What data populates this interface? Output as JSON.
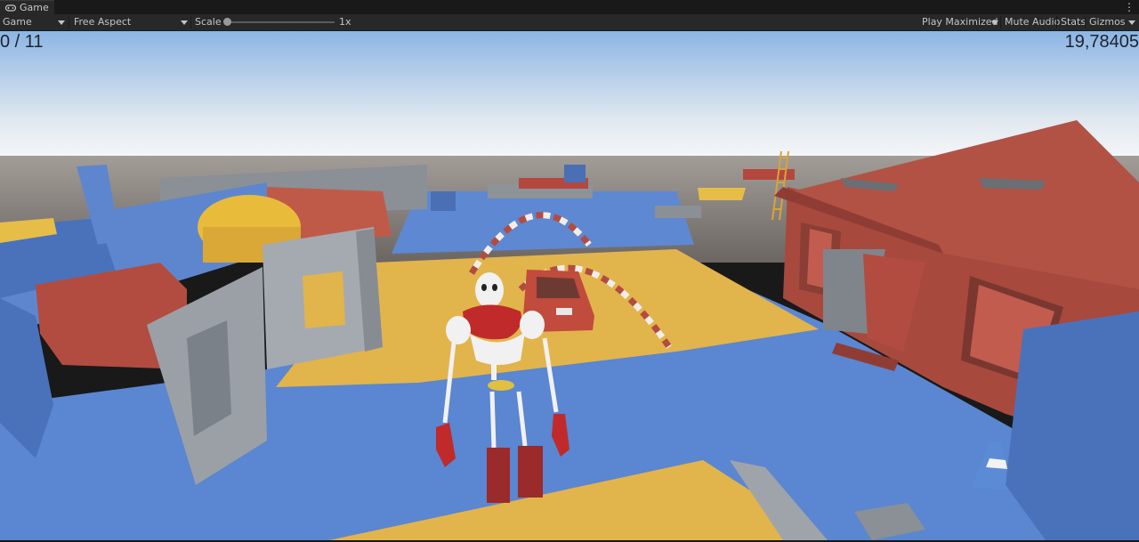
{
  "tab": {
    "title": "Game",
    "icon": "gamepad-icon",
    "menu": "⋮"
  },
  "toolbar": {
    "display": "Game",
    "aspect": "Free Aspect",
    "scale_label": "Scale",
    "scale_value": "1x",
    "scale_fraction": 0.0,
    "play_mode": "Play Maximized",
    "mute": "Mute Audio",
    "stats": "Stats",
    "gizmos": "Gizmos"
  },
  "hud": {
    "counter": "0 / 11",
    "timer": "19,78405"
  },
  "colors": {
    "sky_top": "#8cb6e4",
    "sky_horizon": "#f4f6f8",
    "ground_blue": "#5b86d1",
    "ground_yellow": "#e2b44c",
    "wall_grey": "#9aa0a6",
    "house_red": "#a8493e",
    "roof_red": "#b25245"
  }
}
